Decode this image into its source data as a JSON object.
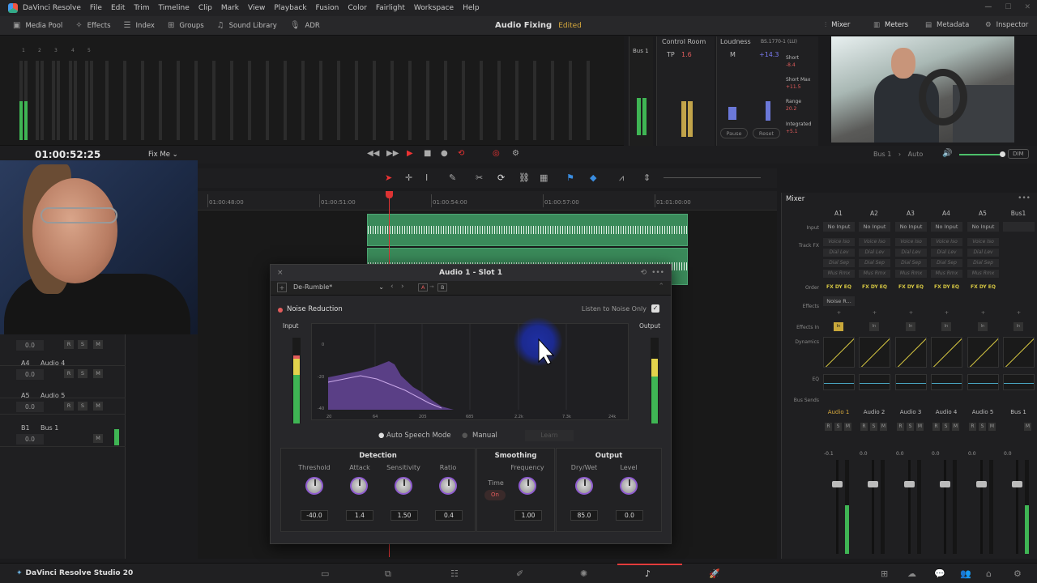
{
  "menubar": {
    "app": "DaVinci Resolve",
    "items": [
      "File",
      "Edit",
      "Trim",
      "Timeline",
      "Clip",
      "Mark",
      "View",
      "Playback",
      "Fusion",
      "Color",
      "Fairlight",
      "Workspace",
      "Help"
    ]
  },
  "toolbar": {
    "left": [
      "Media Pool",
      "Effects",
      "Index",
      "Groups",
      "Sound Library",
      "ADR"
    ],
    "project": "Audio Fixing",
    "status": "Edited",
    "right": [
      "Mixer",
      "Meters",
      "Metadata",
      "Inspector"
    ]
  },
  "meters": {
    "tracks": [
      "1",
      "2",
      "3",
      "4",
      "5"
    ],
    "bus": "Bus 1"
  },
  "control_room": {
    "title": "Control Room",
    "tp_label": "TP",
    "tp_value": "1.6"
  },
  "loudness": {
    "title": "Loudness",
    "standard": "BS.1770-1 (LU)",
    "m_label": "M",
    "m_value": "+14.3",
    "short": "Short",
    "short_val": "-8.4",
    "short_max": "Short Max",
    "short_max_val": "+11.5",
    "range": "Range",
    "range_val": "20.2",
    "integrated": "Integrated",
    "integrated_val": "+5.1",
    "pause": "Pause",
    "reset": "Reset"
  },
  "transport": {
    "timecode": "01:00:52:25",
    "timeline": "Fix Me",
    "bus": "Bus 1",
    "auto": "Auto",
    "dim": "DIM"
  },
  "ruler": [
    "01:00:48:00",
    "01:00:51:00",
    "01:00:54:00",
    "01:00:57:00",
    "01:01:00:00"
  ],
  "tracks": [
    {
      "id": "",
      "name": "",
      "vol": "0.0"
    },
    {
      "id": "A4",
      "name": "Audio 4",
      "vol": "0.0"
    },
    {
      "id": "A5",
      "name": "Audio 5",
      "vol": "0.0"
    },
    {
      "id": "B1",
      "name": "Bus 1",
      "vol": "0.0"
    }
  ],
  "fx": {
    "title": "Audio 1 - Slot 1",
    "preset": "De-Rumble*",
    "ab_a": "A",
    "ab_b": "B",
    "effect": "Noise Reduction",
    "listen": "Listen to Noise Only",
    "input": "Input",
    "output": "Output",
    "freq_labels": [
      "20",
      "64",
      "205",
      "685",
      "2.2k",
      "7.3k",
      "24k"
    ],
    "db_labels": [
      "0",
      "-20",
      "-40"
    ],
    "auto_mode": "Auto Speech Mode",
    "manual": "Manual",
    "learn": "Learn",
    "detection": {
      "title": "Detection",
      "threshold": "Threshold",
      "attack": "Attack",
      "sensitivity": "Sensitivity",
      "ratio": "Ratio",
      "threshold_val": "-40.0",
      "attack_val": "1.4",
      "sensitivity_val": "1.50",
      "ratio_val": "0.4"
    },
    "smoothing": {
      "title": "Smoothing",
      "time": "Time",
      "frequency": "Frequency",
      "on": "On",
      "freq_val": "1.00"
    },
    "output_p": {
      "title": "Output",
      "drywet": "Dry/Wet",
      "level": "Level",
      "drywet_val": "85.0",
      "level_val": "0.0"
    }
  },
  "mixer": {
    "title": "Mixer",
    "rows": [
      "Input",
      "Track FX",
      "Order",
      "Effects",
      "Effects In",
      "Dynamics",
      "EQ",
      "Bus Sends"
    ],
    "cols": [
      "A1",
      "A2",
      "A3",
      "A4",
      "A5",
      "Bus1"
    ],
    "no_input": "No Input",
    "fx_chain": [
      "Voice Iso",
      "Dial Lev",
      "Dial Sep",
      "Mus Rmx"
    ],
    "order": "FX DY EQ",
    "noise_fx": "Noise R...",
    "in": "In",
    "channels": [
      "Audio 1",
      "Audio 2",
      "Audio 3",
      "Audio 4",
      "Audio 5",
      "Bus 1"
    ],
    "db": [
      "-0.1",
      "0.0",
      "0.0",
      "0.0",
      "0.0",
      "0.0"
    ]
  },
  "footer": {
    "brand": "DaVinci Resolve Studio 20"
  }
}
